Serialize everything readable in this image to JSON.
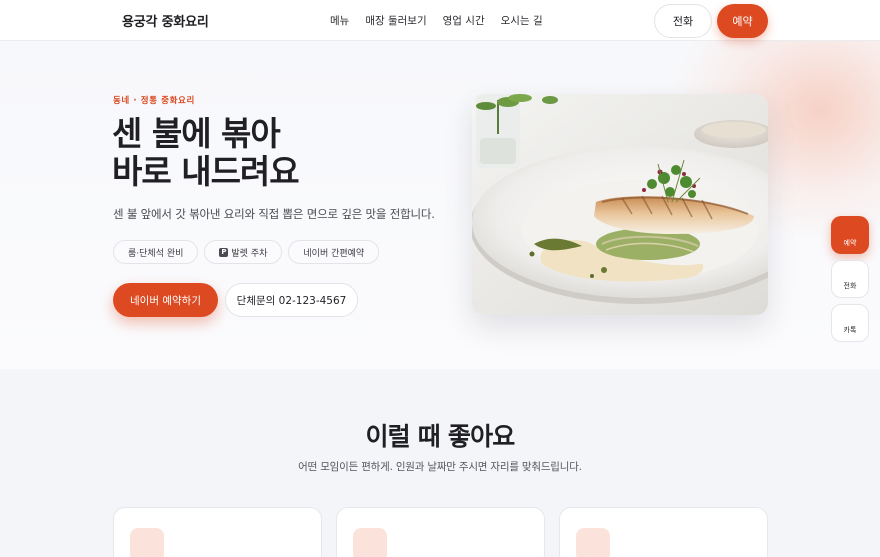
{
  "nav": {
    "brand": "용궁각 중화요리",
    "links": [
      "메뉴",
      "매장 둘러보기",
      "영업 시간",
      "오시는 길"
    ],
    "call_label": "전화",
    "book_label": "예약"
  },
  "hero": {
    "eyebrow": "동네 · 정통 중화요리",
    "title_line1": "센 불에 볶아",
    "title_line2": "바로 내드려요",
    "subtitle": "센 불 앞에서 갓 볶아낸 요리와 직접 뽑은 면으로 깊은 맛을 전합니다.",
    "chips": [
      "룸·단체석 완비",
      "발렛 주차",
      "네이버 간편예약"
    ],
    "parking_badge": "P",
    "cta_primary": "네이버 예약하기",
    "cta_secondary": "단체문의 02-123-4567"
  },
  "floating": {
    "book": "예약",
    "call": "전화",
    "kakao": "카톡"
  },
  "section": {
    "title": "이럴 때 좋아요",
    "subtitle": "어떤 모임이든 편하게. 인원과 날짜만 주시면 자리를 맞춰드립니다."
  },
  "colors": {
    "accent": "#dd4a22",
    "text": "#1f1f24",
    "section_bg": "#f4f5f9"
  }
}
